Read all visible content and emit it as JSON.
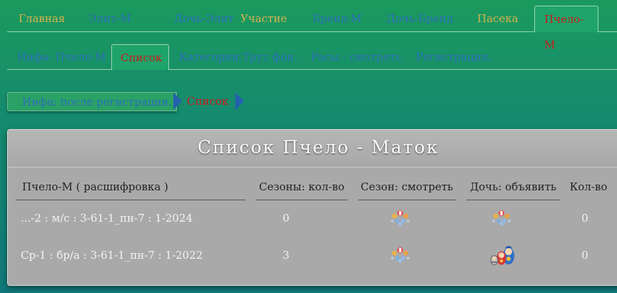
{
  "top_tabs": [
    {
      "label": "Главная"
    },
    {
      "label": "Элит-М"
    },
    {
      "label": "Дочь-Элит"
    },
    {
      "label": "Участие"
    },
    {
      "label": "Бренд-М"
    },
    {
      "label": "Дочь-Бренд"
    },
    {
      "label": "Пасека"
    },
    {
      "label": "Пчело-М",
      "active": true
    }
  ],
  "sub_tabs": [
    {
      "label": "Инфа: Пчело-М"
    },
    {
      "label": "Список",
      "active": true
    },
    {
      "label": "Категории.Трут фон."
    },
    {
      "label": "Расы - смотреть"
    },
    {
      "label": "Регистрация."
    }
  ],
  "breadcrumb": {
    "first": "Инфа: после регистрации.",
    "second": "Список"
  },
  "panel": {
    "title": "Список Пчело - Маток",
    "columns": [
      "Пчело-М ( расшифровка )",
      "Сезоны: кол-во",
      "Сезон: смотреть",
      "Дочь: объявить",
      "Кол-во"
    ],
    "rows": [
      {
        "name": "...-2 : м/с : 3-61-1_пн-7 : 1-2024",
        "seasons": "0",
        "view_icon": "bee-cluster-icon",
        "announce_icon": "bee-cluster-icon",
        "count": "0"
      },
      {
        "name": "Ср-1 : бр/а : 3-61-1_пн-7 : 1-2022",
        "seasons": "3",
        "view_icon": "bee-cluster-icon",
        "announce_icon": "matryoshka-dolls-icon",
        "count": "0"
      }
    ]
  },
  "colors": {
    "active_text": "#c81a1a",
    "link_blue": "#2b6fb8",
    "tab_gold": "#d8b14a",
    "panel_grey": "#a9a9a9"
  }
}
